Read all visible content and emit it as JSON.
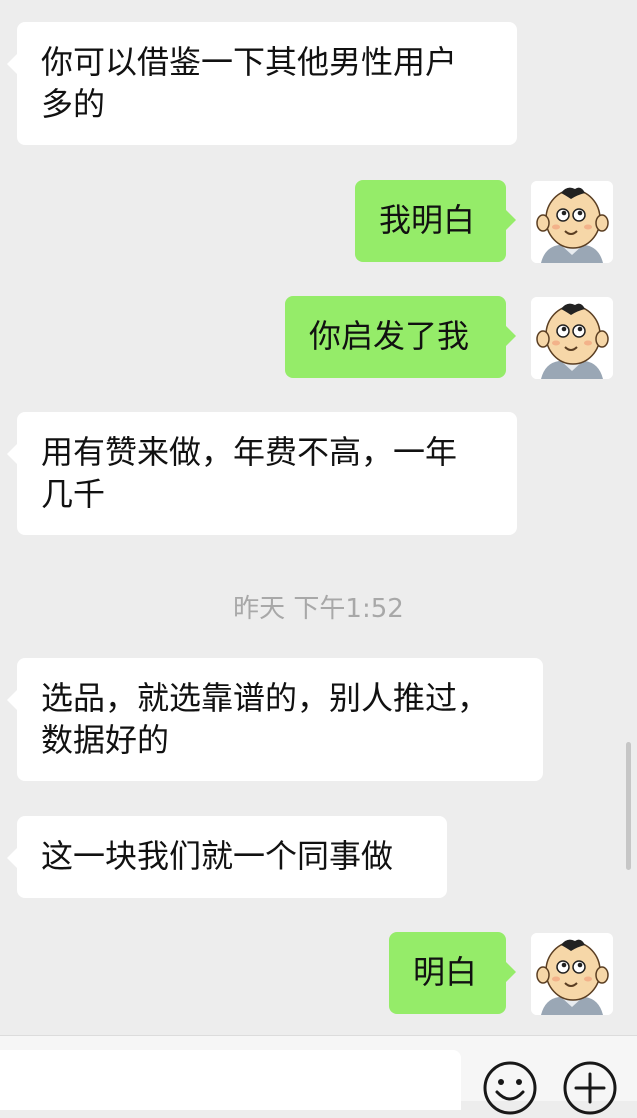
{
  "messages": [
    {
      "side": "in",
      "text": "你可以借鉴一下其他男性用户\n多的"
    },
    {
      "side": "out",
      "text": "我明白"
    },
    {
      "side": "out",
      "text": "你启发了我"
    },
    {
      "side": "in",
      "text": "用有赞来做，年费不高，一年\n几千"
    },
    {
      "side": "in",
      "text": "选品，就选靠谱的，别人推过，\n数据好的"
    },
    {
      "side": "in",
      "text": "这一块我们就一个同事做"
    },
    {
      "side": "out",
      "text": "明白"
    }
  ],
  "timestamp": "昨天 下午1:52",
  "input": {
    "emoji_icon": "smiley-face-icon",
    "more_icon": "plus-circle-icon"
  },
  "avatar_icon": "cartoon-baby-avatar-icon",
  "colors": {
    "background": "#ededed",
    "incoming_bubble": "#ffffff",
    "outgoing_bubble": "#95ec69",
    "timestamp_text": "#a8a8a8"
  }
}
